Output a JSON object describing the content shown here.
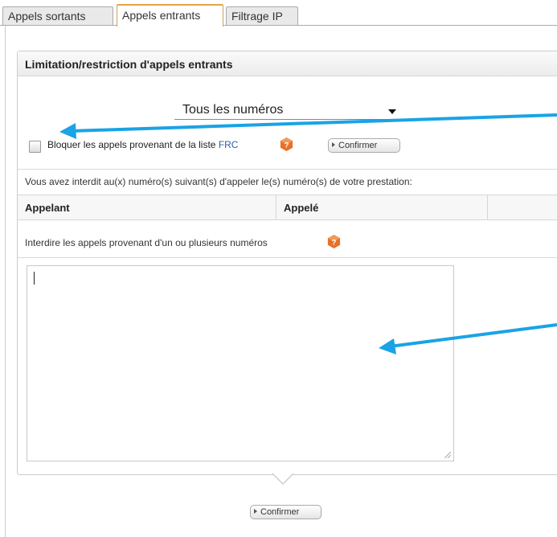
{
  "tabs": [
    {
      "label": "Appels sortants"
    },
    {
      "label": "Appels entrants"
    },
    {
      "label": "Filtrage IP"
    }
  ],
  "panel": {
    "title": "Limitation/restriction d'appels entrants",
    "select_value": "Tous les numéros",
    "block_label_prefix": "Bloquer les appels provenant de la liste",
    "block_link": "FRC",
    "confirm_label": "Confirmer",
    "info_text": "Vous avez interdit au(x) numéro(s) suivant(s) d'appeler le(s) numéro(s) de votre prestation:",
    "table_headers": [
      "Appelant",
      "Appelé"
    ],
    "forbid_text": "Interdire les appels provenant d'un ou plusieurs numéros",
    "textarea_value": ""
  },
  "footer": {
    "confirm_label": "Confirmer"
  },
  "colors": {
    "accent_tab": "#e3a548",
    "annotation_arrow": "#1aa3e6",
    "help_icon": "#e8702a",
    "link": "#2a5ea8"
  },
  "icons": {
    "help": "help-icon",
    "dropdown": "chevron-down-icon"
  }
}
